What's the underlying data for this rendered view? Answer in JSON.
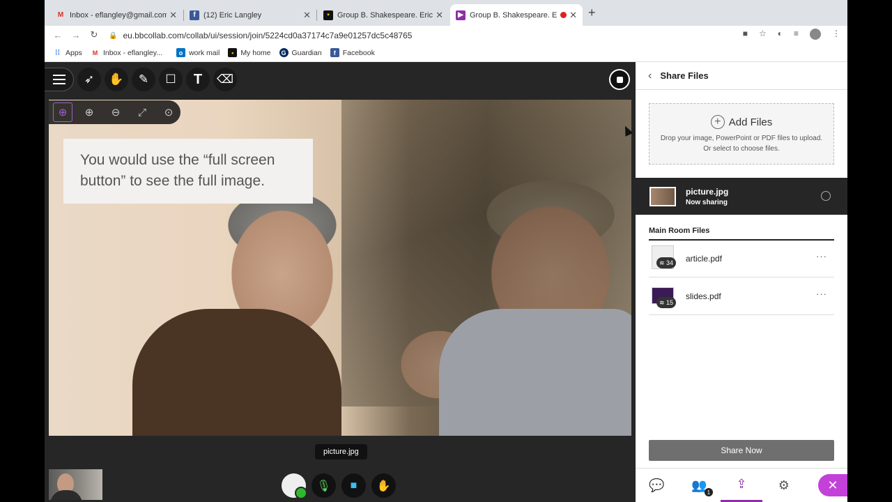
{
  "browser": {
    "tabs": [
      {
        "title": "Inbox - eflangley@gmail.com -",
        "icon": "gmail-icon"
      },
      {
        "title": "(12) Eric Langley",
        "icon": "facebook-icon"
      },
      {
        "title": "Group B. Shakespeare. Eric La",
        "icon": "collab-icon"
      },
      {
        "title": "Group B. Shakespeare. Eric",
        "icon": "collab-active-icon"
      }
    ],
    "url": "eu.bbcollab.com/collab/ui/session/join/5224cd0a37174c7a9e01257dc5c48765",
    "bookmarks": [
      "Apps",
      "Inbox - eflangley...",
      "work mail",
      "My home",
      "Guardian",
      "Facebook"
    ]
  },
  "stage": {
    "overlay_text": "You would use the “full screen button” to see the full image.",
    "file_label": "picture.jpg"
  },
  "panel": {
    "title": "Share Files",
    "add_files": "Add Files",
    "drop_hint_1": "Drop your image, PowerPoint or PDF files to upload.",
    "drop_hint_2": "Or select to choose files.",
    "now_sharing_name": "picture.jpg",
    "now_sharing_status": "Now sharing",
    "section_title": "Main Room Files",
    "files": [
      {
        "name": "article.pdf",
        "pages": "34"
      },
      {
        "name": "slides.pdf",
        "pages": "15"
      }
    ],
    "share_button": "Share Now",
    "attendees_count": "1"
  },
  "colors": {
    "accent": "#8d2ea8",
    "close": "#c341d9",
    "stage_bg": "#262626"
  }
}
